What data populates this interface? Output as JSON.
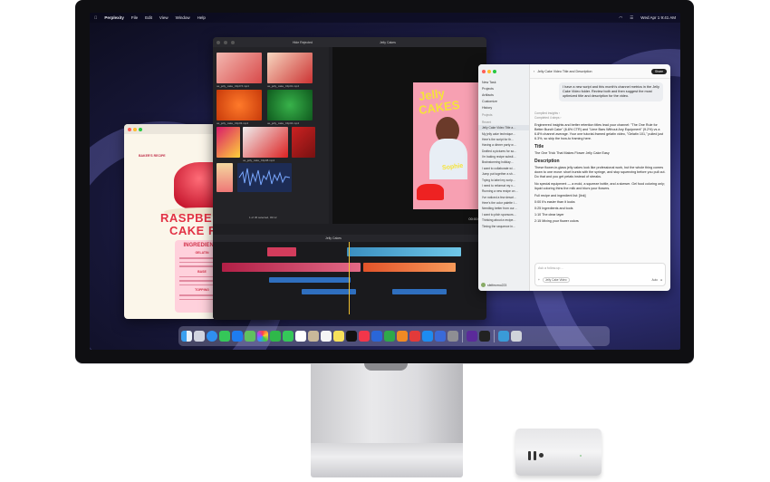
{
  "menubar": {
    "app_name": "Perplexity",
    "items": [
      "File",
      "Edit",
      "View",
      "Window",
      "Help"
    ],
    "clock": "Wed Apr 1  9:41 AM"
  },
  "recipe": {
    "small_heading": "BAKER'S RECIPE",
    "title_line1": "RASPBERRY",
    "title_line2": "CAKE REC",
    "ingredients_heading": "INGREDIENTS",
    "subheads": [
      "GELATIN",
      "BASE",
      "TOPPING"
    ]
  },
  "fcp": {
    "toolbar_label": "Hide Rejected",
    "viewer_label": "Jelly Cakes",
    "timeline_label": "Jelly Cakes",
    "timecode": "00:00:00",
    "browser_summary": "1 of 36 selected, 03:12",
    "clip_labels": [
      "ue_jelly_cake_Clip0 5.mp4",
      "ue_jelly_cake_Clip01.mp4",
      "ue_jelly_cake_Clip03.mp4",
      "ue_jelly_cake_Clip04.mp4",
      "ue_jelly_cake_Clip08.mp4",
      "ue_jelly_cake_Clip14.mp4",
      "ue_jelly_cake_Clip09.mp4",
      "ue_jelly_cake_Clip07.mp4",
      "ue_jelly_cake_Clip11.mp4",
      "ue_jelly_cake_Clip12.mp4"
    ],
    "poster_line1": "Jelly",
    "poster_line2": "CAKES",
    "poster_name": "Sophie"
  },
  "chat": {
    "header_title": "Jelly Cake Video Title and Description",
    "share_label": "Share",
    "sidebar": {
      "items": [
        "New Task",
        "Projects",
        "Artifacts",
        "Customize",
        "History"
      ],
      "projects_label": "Projects",
      "recents_label": "Recent",
      "recents": [
        "Jelly Cake Video Title a…",
        "My jelly cake technique…",
        "Here's the script for th…",
        "Having a dinner party w…",
        "Drafted a pictures for so…",
        "I'm baking recipe substi…",
        "Brainstorming holiday…",
        "I want to collaborate wi…",
        "Jump put together a sh…",
        "Trying to label my scrip…",
        "I need to reformat my v…",
        "Running a new recipe on…",
        "I've noticed a few descri…",
        "Here's the color palette i…",
        "Needling better from our…",
        "I want to pitch sponsors…",
        "Thinking about a recipe…",
        "Timing the sequence in…"
      ],
      "user": "sfelfrezmo223"
    },
    "user_message": "I have a new script and this month's channel metrics in the Jelly Cake Video folder. Review both and then suggest the most optimized title and description for the video.",
    "step1": "Compiled insights  ›",
    "step2": "Completed 4 steps  ›",
    "intro": "Engineered insights and better retention titles lead your channel: \"The One Rule for Better Bundt Cake\" (6.8% CTR) and \"Lime Bars Without Any Equipment\" (9.2%) vs a 6.8% channel average. Your one tutorial-framed gelatin video, \"Gelatin 101,\" pulled just 6.3%, so skip the how-to framing here.",
    "title_heading": "Title",
    "title_text": "The One Trick That Makes Flower Jelly Cake Easy",
    "desc_heading": "Description",
    "desc_text": "These flower-in-glass jelly cakes look like professional work, but the whole thing comes down to one move: short bursts with the syringe, and stop squeezing before you pull out. Do that and you get petals instead of streaks.",
    "desc_text2": "No special equipment — a mold, a squeeze bottle, and a skewer. Gel food coloring only; liquid coloring thins the milk and blurs your flowers.",
    "links_intro": "Full recipe and ingredient list: [link]",
    "chapters": [
      "0:00 It's easier than it looks",
      "0:25 Ingredients and tools",
      "1:10 The clear layer",
      "2:15 Mixing your flower colors"
    ],
    "composer_placeholder": "Ask a follow-up…",
    "composer_folder": "Jelly Cake Video",
    "composer_model": "Auto"
  },
  "dock_apps": [
    "Finder",
    "Launchpad",
    "Safari",
    "Messages",
    "Mail",
    "Maps",
    "Photos",
    "FaceTime",
    "Phone",
    "Calendar",
    "Contacts",
    "Reminders",
    "Notes",
    "TV",
    "Music",
    "Keynote",
    "Numbers",
    "Pages",
    "Tasks",
    "App Store",
    "Preview",
    "Settings",
    "Final Cut Pro",
    "Perplexity",
    "Downloads",
    "Trash"
  ],
  "colors": {
    "accent_red": "#e23244",
    "wallpaper": "#2b2c6e",
    "share_bg": "#222222"
  }
}
